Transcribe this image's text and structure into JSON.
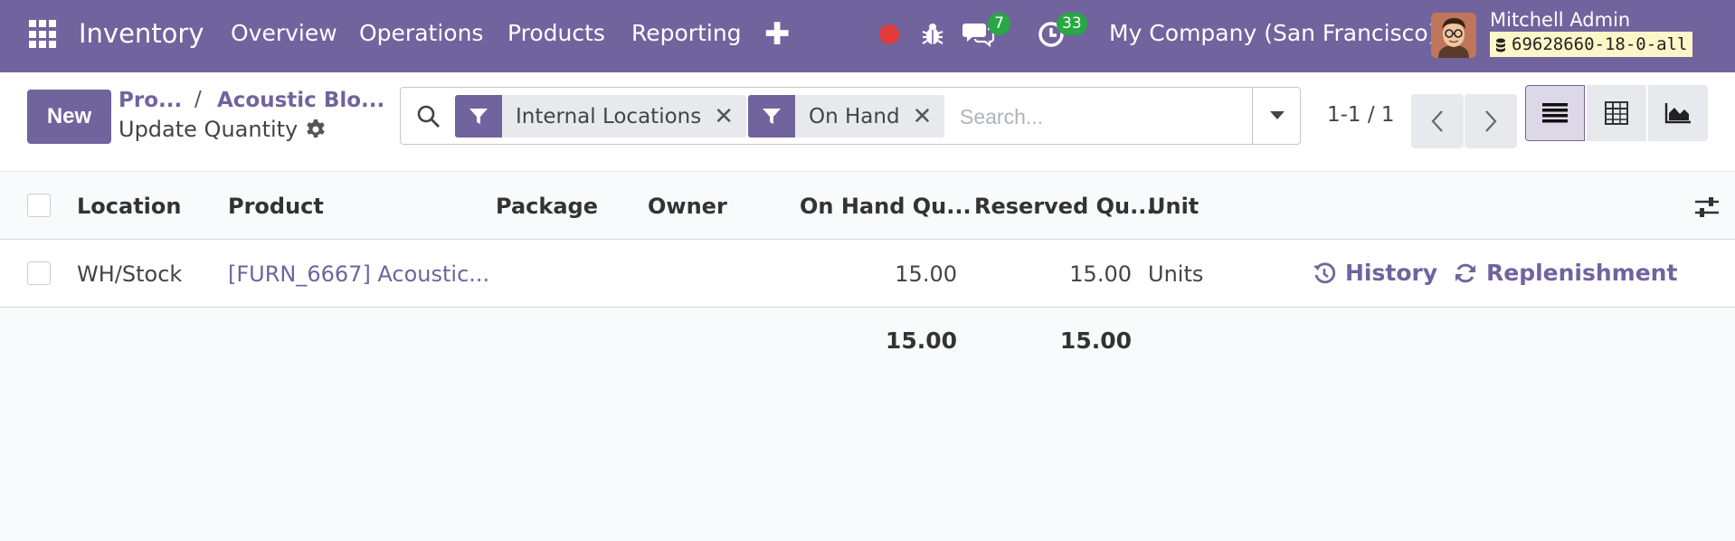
{
  "navbar": {
    "brand": "Inventory",
    "menu": [
      "Overview",
      "Operations",
      "Products",
      "Reporting"
    ],
    "messages_count": "7",
    "activities_count": "33",
    "company": "My Company (San Francisco)",
    "user_name": "Mitchell Admin",
    "database": "69628660-18-0-all",
    "color": "#71639e"
  },
  "control": {
    "new_label": "New",
    "breadcrumb": [
      "Pro...",
      "Acoustic Blo..."
    ],
    "current": "Update Quantity",
    "filters": [
      "Internal Locations",
      "On Hand"
    ],
    "search_placeholder": "Search...",
    "pager": "1-1 / 1",
    "views": [
      "list-icon",
      "pivot-icon",
      "graph-icon"
    ]
  },
  "table": {
    "columns": [
      "Location",
      "Product",
      "Package",
      "Owner",
      "On Hand Qu...",
      "Reserved Qu...",
      "Unit"
    ],
    "rows": [
      {
        "location": "WH/Stock",
        "product": "[FURN_6667] Acoustic...",
        "package": "",
        "owner": "",
        "on_hand": "15.00",
        "reserved": "15.00",
        "unit": "Units",
        "actions": [
          "History",
          "Replenishment"
        ]
      }
    ],
    "totals": {
      "on_hand": "15.00",
      "reserved": "15.00"
    }
  }
}
